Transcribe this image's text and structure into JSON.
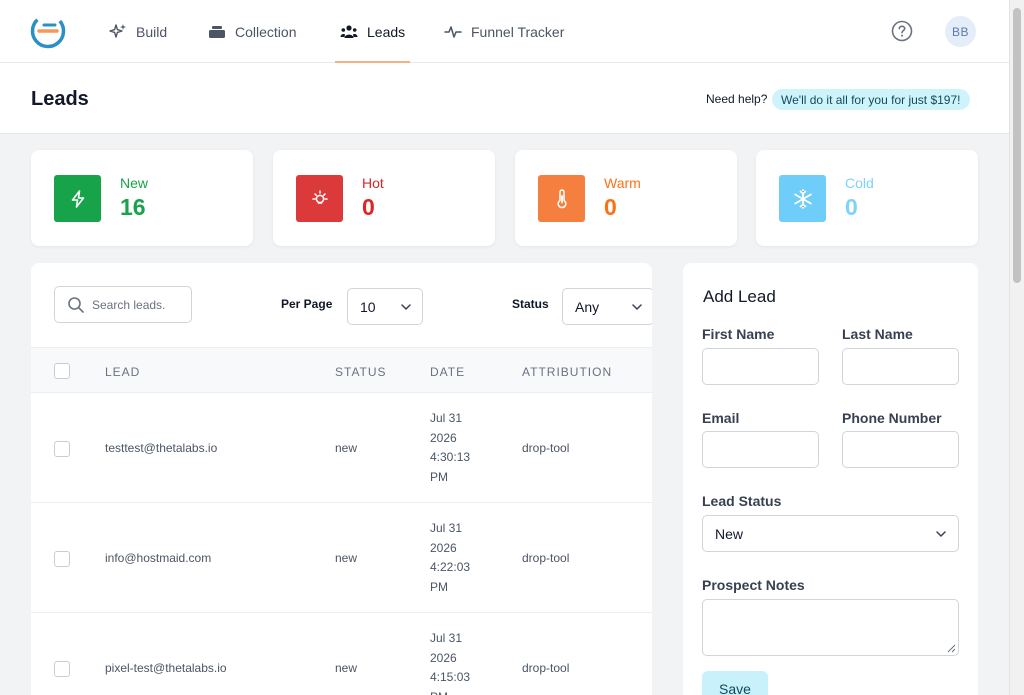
{
  "nav": {
    "items": [
      {
        "label": "Build",
        "icon": "sparkle-icon"
      },
      {
        "label": "Collection",
        "icon": "collection-icon"
      },
      {
        "label": "Leads",
        "icon": "users-icon",
        "active": true
      },
      {
        "label": "Funnel Tracker",
        "icon": "activity-icon"
      }
    ],
    "avatar_initials": "BB"
  },
  "header": {
    "title": "Leads",
    "help_text": "Need help?",
    "promo_text": "We'll do it all for you for just $197!"
  },
  "stats": [
    {
      "label": "New",
      "value": "16",
      "color": "#16a34a",
      "icon": "bolt-icon"
    },
    {
      "label": "Hot",
      "value": "0",
      "color": "#dc2626",
      "icon": "lightbulb-icon"
    },
    {
      "label": "Warm",
      "value": "0",
      "color": "#f97316",
      "icon": "thermometer-icon"
    },
    {
      "label": "Cold",
      "value": "0",
      "color": "#7dd3fc",
      "icon": "snowflake-icon"
    }
  ],
  "table": {
    "search_placeholder": "Search leads.",
    "per_page_label": "Per Page",
    "per_page_value": "10",
    "status_label": "Status",
    "status_value": "Any",
    "columns": [
      "LEAD",
      "STATUS",
      "DATE",
      "ATTRIBUTION"
    ],
    "rows": [
      {
        "lead": "testtest@thetalabs.io",
        "status": "new",
        "date": [
          "Jul 31",
          "2026",
          "4:30:13",
          "PM"
        ],
        "attribution": "drop-tool"
      },
      {
        "lead": "info@hostmaid.com",
        "status": "new",
        "date": [
          "Jul 31",
          "2026",
          "4:22:03",
          "PM"
        ],
        "attribution": "drop-tool"
      },
      {
        "lead": "pixel-test@thetalabs.io",
        "status": "new",
        "date": [
          "Jul 31",
          "2026",
          "4:15:03",
          "PM"
        ],
        "attribution": "drop-tool"
      }
    ]
  },
  "add_lead": {
    "title": "Add Lead",
    "first_name_label": "First Name",
    "last_name_label": "Last Name",
    "email_label": "Email",
    "phone_label": "Phone Number",
    "status_label": "Lead Status",
    "status_value": "New",
    "notes_label": "Prospect Notes",
    "save_label": "Save"
  },
  "colors": {
    "accent_underline": "#f4b183",
    "promo_bg": "#cff3fb"
  }
}
